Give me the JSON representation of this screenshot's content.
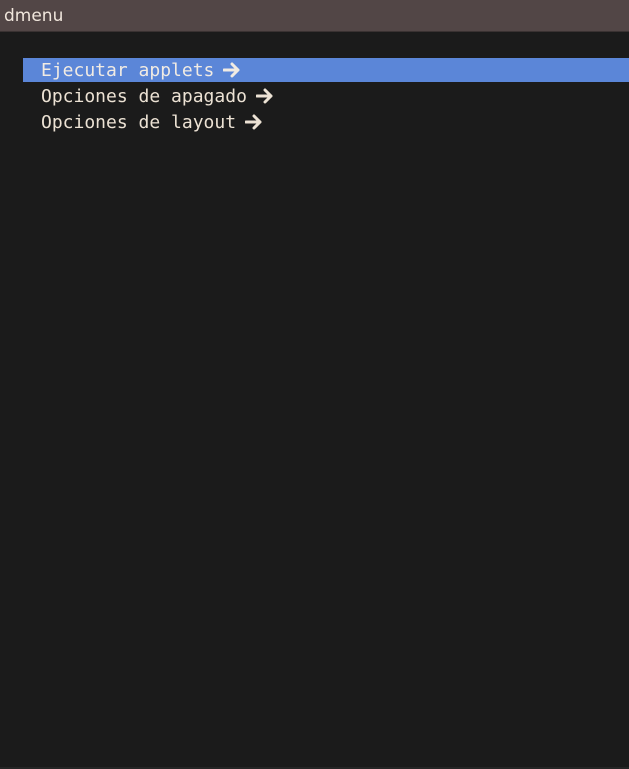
{
  "window": {
    "title": "dmenu"
  },
  "menu": {
    "items": [
      {
        "label": "Ejecutar applets",
        "icon": "arrow-right-icon",
        "selected": true
      },
      {
        "label": "Opciones de apagado",
        "icon": "arrow-right-icon",
        "selected": false
      },
      {
        "label": "Opciones de layout",
        "icon": "arrow-right-icon",
        "selected": false
      }
    ]
  },
  "colors": {
    "titlebar": "#524646",
    "background": "#1b1b1b",
    "selection": "#5b86d8",
    "text": "#ece2d4"
  }
}
